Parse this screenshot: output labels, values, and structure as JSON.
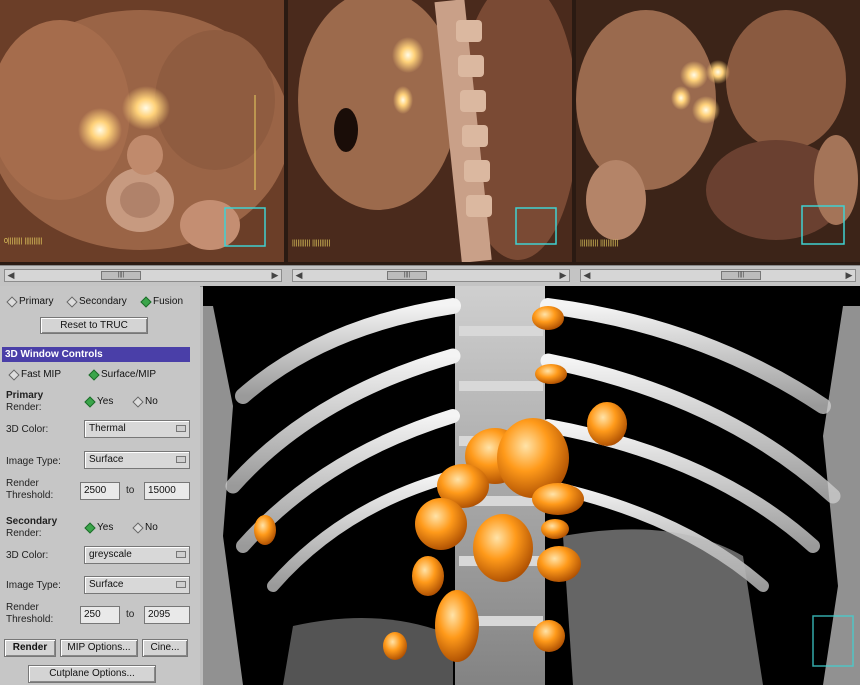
{
  "viewer": {
    "panes": [
      {
        "name": "axial",
        "caption": "0|||||||| ||||||||||"
      },
      {
        "name": "sagittal",
        "caption": "|||||||||| ||||||||||"
      },
      {
        "name": "coronal",
        "caption": "|||||||||| ||||||||||"
      }
    ]
  },
  "sliders": [
    {
      "label": "||||"
    },
    {
      "label": "||||"
    },
    {
      "label": "||||"
    }
  ],
  "controls": {
    "view_mode": {
      "options": [
        "Primary",
        "Secondary",
        "Fusion"
      ],
      "selected": "Fusion"
    },
    "reset_button": "Reset to TRUC",
    "section_title": "3D Window Controls",
    "render_mode": {
      "options": [
        "Fast MIP",
        "Surface/MIP"
      ],
      "selected": "Surface/MIP"
    },
    "primary": {
      "heading": "Primary",
      "render_label": "Render:",
      "render_options": [
        "Yes",
        "No"
      ],
      "render_selected": "Yes",
      "color_label": "3D Color:",
      "color_value": "Thermal",
      "type_label": "Image Type:",
      "type_value": "Surface",
      "threshold_label_1": "Render",
      "threshold_label_2": "Threshold:",
      "threshold_min": "2500",
      "to_label": "to",
      "threshold_max": "15000"
    },
    "secondary": {
      "heading": "Secondary",
      "render_label": "Render:",
      "render_options": [
        "Yes",
        "No"
      ],
      "render_selected": "Yes",
      "color_label": "3D Color:",
      "color_value": "greyscale",
      "type_label": "Image Type:",
      "type_value": "Surface",
      "threshold_label_1": "Render",
      "threshold_label_2": "Threshold:",
      "threshold_min": "250",
      "to_label": "to",
      "threshold_max": "2095"
    },
    "buttons": {
      "render": "Render",
      "mip_options": "MIP Options...",
      "cine": "Cine...",
      "cutplane": "Cutplane Options..."
    }
  },
  "colors": {
    "accent_title": "#4a3fa8",
    "radio_on": "#3aa54a",
    "hot_spot": "#ff9a1a"
  }
}
